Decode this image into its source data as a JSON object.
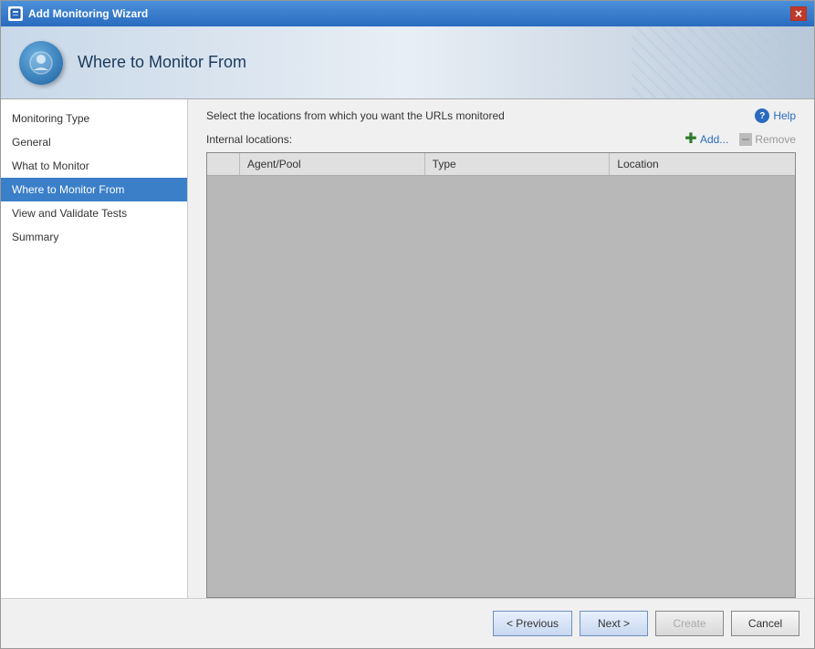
{
  "window": {
    "title": "Add Monitoring Wizard",
    "close_label": "✕"
  },
  "header": {
    "title": "Where to Monitor From"
  },
  "help": {
    "label": "Help"
  },
  "sidebar": {
    "items": [
      {
        "id": "monitoring-type",
        "label": "Monitoring Type",
        "active": false
      },
      {
        "id": "general",
        "label": "General",
        "active": false
      },
      {
        "id": "what-to-monitor",
        "label": "What to Monitor",
        "active": false
      },
      {
        "id": "where-to-monitor",
        "label": "Where to Monitor From",
        "active": true
      },
      {
        "id": "view-validate",
        "label": "View and Validate Tests",
        "active": false
      },
      {
        "id": "summary",
        "label": "Summary",
        "active": false
      }
    ]
  },
  "content": {
    "instruction": "Select the locations from which you want the URLs monitored",
    "internal_locations_label": "Internal locations:",
    "add_label": "Add...",
    "remove_label": "Remove",
    "table": {
      "columns": [
        {
          "id": "checkbox",
          "label": ""
        },
        {
          "id": "agent-pool",
          "label": "Agent/Pool"
        },
        {
          "id": "type",
          "label": "Type"
        },
        {
          "id": "location",
          "label": "Location"
        }
      ],
      "rows": []
    }
  },
  "buttons": {
    "previous_label": "< Previous",
    "next_label": "Next >",
    "create_label": "Create",
    "cancel_label": "Cancel"
  }
}
